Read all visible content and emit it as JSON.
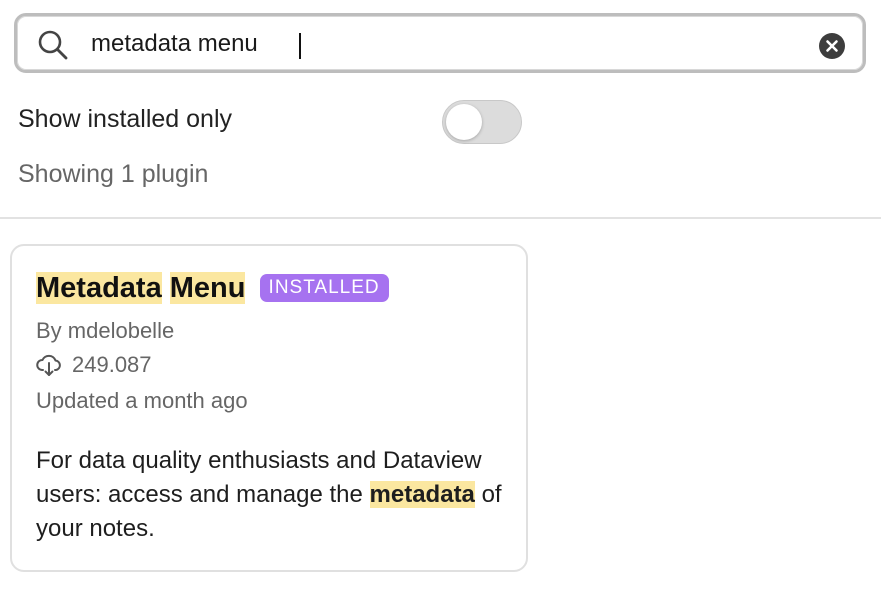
{
  "search": {
    "value": "metadata menu",
    "icon": "search-icon",
    "clear_icon": "clear-circle-icon"
  },
  "filter": {
    "show_installed_label": "Show installed only",
    "show_installed_enabled": false
  },
  "results": {
    "count_text": "Showing 1 plugin"
  },
  "plugins": [
    {
      "name_part1": "Metadata",
      "name_part2": "Menu",
      "badge": "INSTALLED",
      "author": "By mdelobelle",
      "downloads": "249.087",
      "downloads_icon": "download-cloud-icon",
      "updated": "Updated a month ago",
      "description_before": "For data quality enthusiasts and Dataview users: access and manage the ",
      "description_highlight": "metadata",
      "description_after": " of your notes."
    }
  ],
  "colors": {
    "highlight": "#fbe7a0",
    "badge": "#a672f0",
    "muted_text": "#666666"
  }
}
